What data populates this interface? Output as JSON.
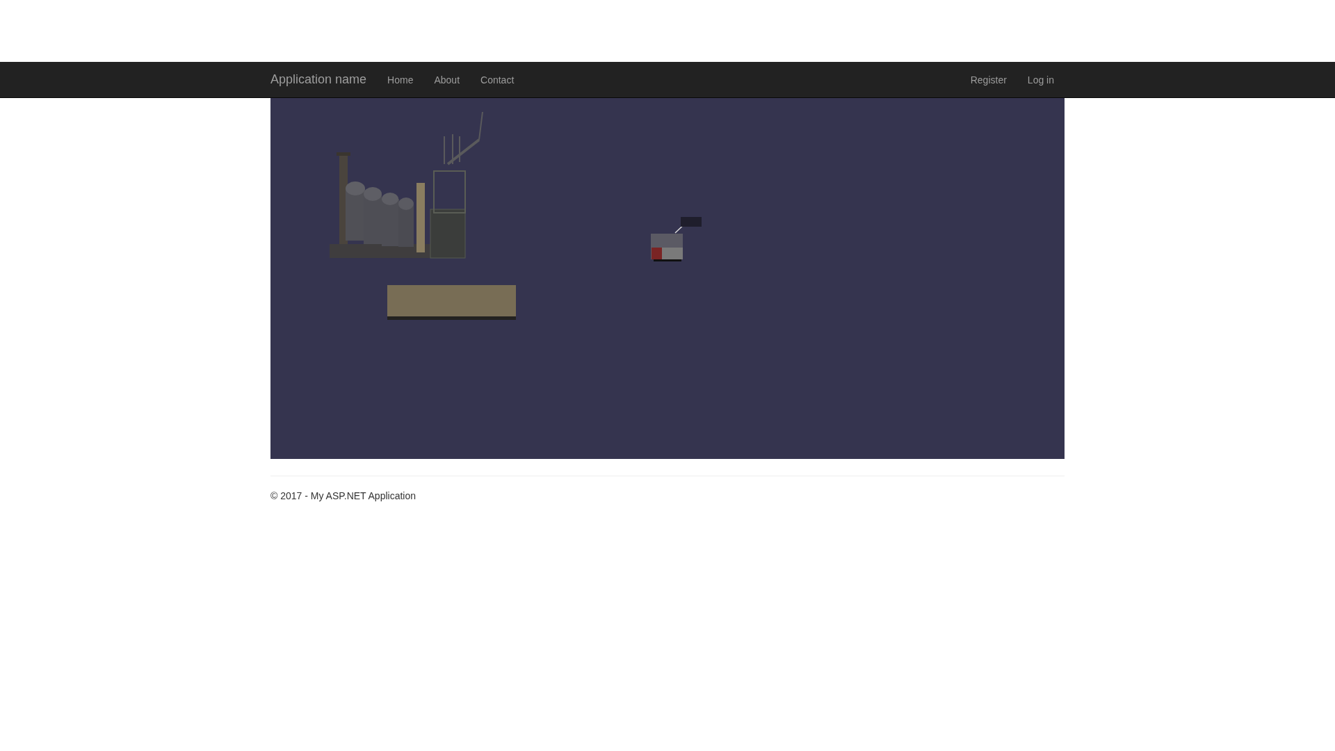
{
  "navbar": {
    "brand": "Application name",
    "links": [
      "Home",
      "About",
      "Contact"
    ],
    "account_links": [
      "Register",
      "Log in"
    ]
  },
  "footer": {
    "text": "© 2017 - My ASP.NET Application"
  }
}
